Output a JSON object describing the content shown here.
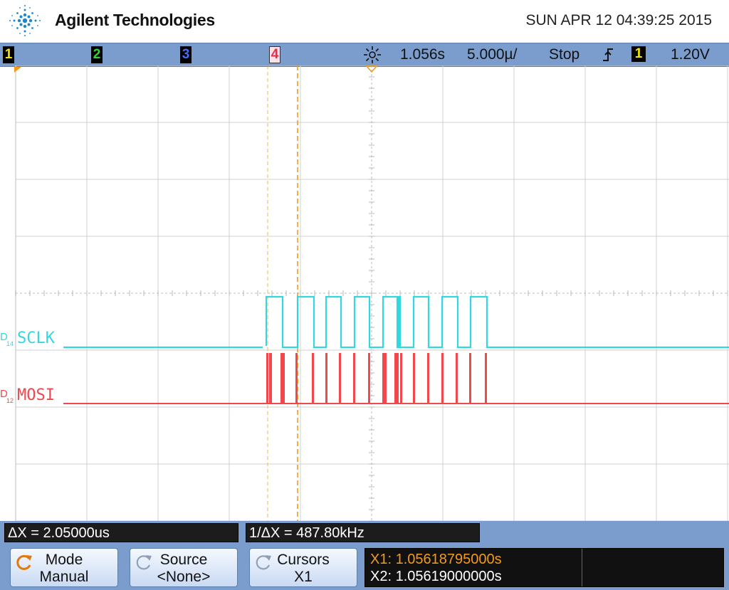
{
  "header": {
    "brand": "Agilent Technologies",
    "datetime": "SUN APR 12 04:39:25 2015"
  },
  "status": {
    "channels": [
      {
        "label": "1",
        "color": "#f2e60a"
      },
      {
        "label": "2",
        "color": "#35d137"
      },
      {
        "label": "3",
        "color": "#4b6df5"
      },
      {
        "label": "4",
        "color": "#ea2a4d"
      }
    ],
    "trigger_time": "1.056s",
    "timebase": "5.000µ/",
    "run_state": "Stop",
    "trigger_source": "1",
    "trigger_level": "1.20V",
    "icons": {
      "acquire": "sun-burst-icon",
      "edge": "rising-edge-icon"
    }
  },
  "signals": [
    {
      "prefix": "D",
      "sub": "14",
      "name": "SCLK",
      "color": "#33d7e0"
    },
    {
      "prefix": "D",
      "sub": "12",
      "name": "MOSI",
      "color": "#f0484c"
    }
  ],
  "measurements": {
    "delta_x": "ΔX = 2.05000us",
    "inverse_delta_x": "1/ΔX = 487.80kHz"
  },
  "softkeys": [
    {
      "line1": "Mode",
      "line2": "Manual",
      "icon": "rotate-knob-icon",
      "active": true
    },
    {
      "line1": "Source",
      "line2": "<None>",
      "icon": "rotate-knob-icon",
      "active": false
    },
    {
      "line1": "Cursors",
      "line2": "X1",
      "icon": "rotate-knob-icon",
      "active": false
    }
  ],
  "cursor_readout": {
    "x1": "X1: 1.05618795000s",
    "x2": "X2: 1.05619000000s"
  },
  "colors": {
    "toolbar": "#7a9dce",
    "cursor": "#f49a1a",
    "sclk": "#33d7e0",
    "mosi": "#f0484c"
  }
}
